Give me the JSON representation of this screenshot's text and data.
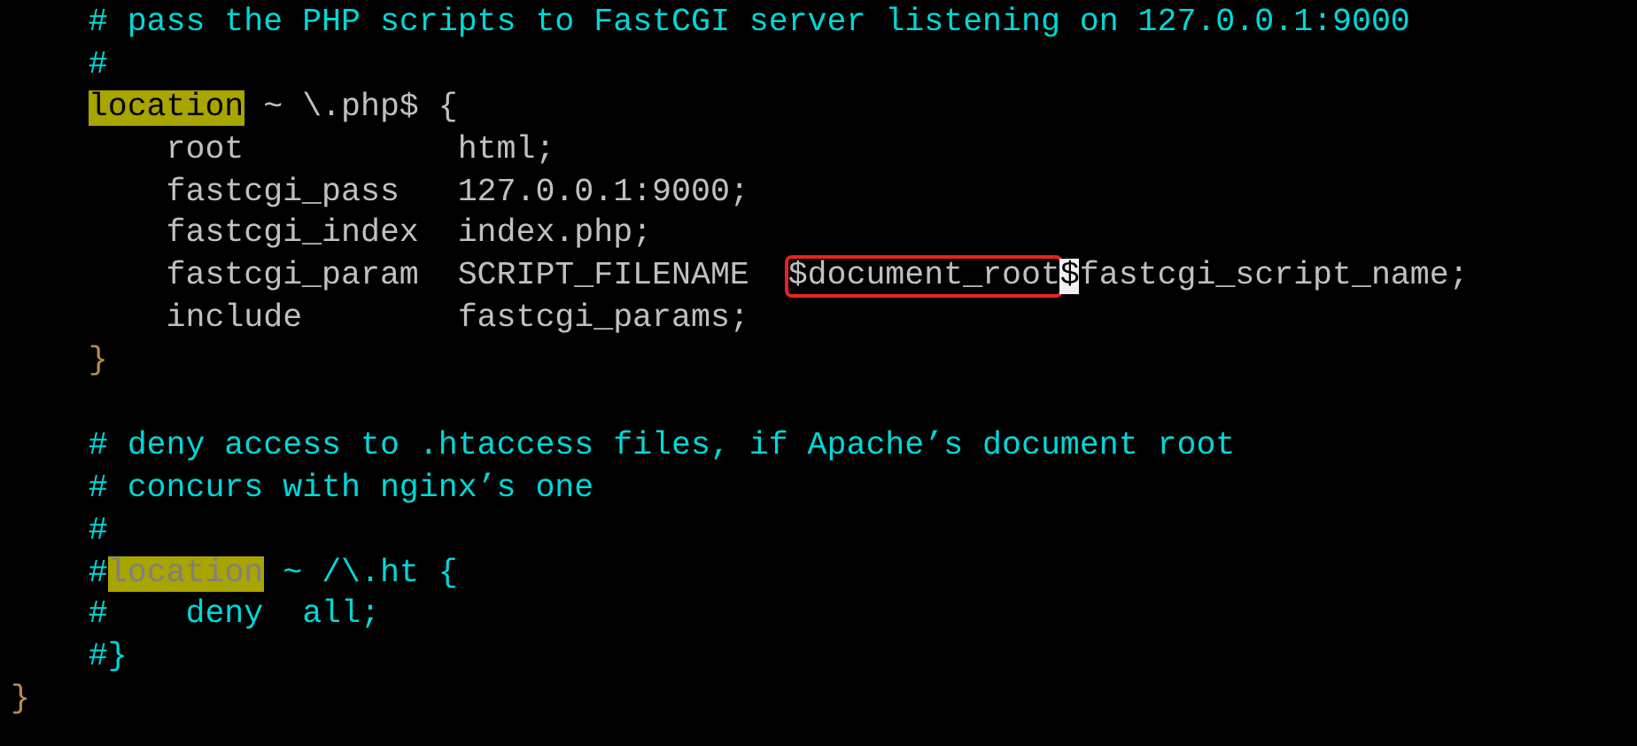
{
  "lines": [
    {
      "kind": "code",
      "segments": [
        {
          "kind": "comment",
          "text": "    # pass the PHP scripts to FastCGI server listening on 127.0.0.1:9000"
        }
      ]
    },
    {
      "kind": "code",
      "segments": [
        {
          "kind": "comment",
          "text": "    #"
        }
      ]
    },
    {
      "kind": "code",
      "segments": [
        {
          "kind": "keyword",
          "text": "    location"
        },
        {
          "kind": "plain",
          "text": " ~ \\.php$ {"
        }
      ]
    },
    {
      "kind": "code",
      "segments": [
        {
          "kind": "plain",
          "text": "        root           html;"
        }
      ]
    },
    {
      "kind": "code",
      "segments": [
        {
          "kind": "plain",
          "text": "        fastcgi_pass   127.0.0.1:9000;"
        }
      ]
    },
    {
      "kind": "code",
      "segments": [
        {
          "kind": "plain",
          "text": "        fastcgi_index  index.php;"
        }
      ]
    },
    {
      "kind": "code",
      "segments": [
        {
          "kind": "plain",
          "text": "        fastcgi_param  SCRIPT_FILENAME  "
        },
        {
          "kind": "boxed",
          "text": "$document_root"
        },
        {
          "kind": "cursor",
          "text": "$"
        },
        {
          "kind": "plain",
          "text": "fastcgi_script_name;"
        }
      ]
    },
    {
      "kind": "code",
      "segments": [
        {
          "kind": "plain",
          "text": "        include        fastcgi_params;"
        }
      ]
    },
    {
      "kind": "code",
      "segments": [
        {
          "kind": "brace",
          "text": "    }"
        }
      ]
    },
    {
      "kind": "blank"
    },
    {
      "kind": "code",
      "segments": [
        {
          "kind": "comment",
          "text": "    # deny access to .htaccess files, if Apache’s document root"
        }
      ]
    },
    {
      "kind": "code",
      "segments": [
        {
          "kind": "comment",
          "text": "    # concurs with nginx’s one"
        }
      ]
    },
    {
      "kind": "code",
      "segments": [
        {
          "kind": "comment",
          "text": "    #"
        }
      ]
    },
    {
      "kind": "code",
      "segments": [
        {
          "kind": "comment",
          "text": "    #"
        },
        {
          "kind": "keyword-commented",
          "text": "location"
        },
        {
          "kind": "comment",
          "text": " ~ /\\.ht {"
        }
      ]
    },
    {
      "kind": "code",
      "segments": [
        {
          "kind": "comment",
          "text": "    #    deny  all;"
        }
      ]
    },
    {
      "kind": "code",
      "segments": [
        {
          "kind": "comment",
          "text": "    #}"
        }
      ]
    },
    {
      "kind": "code",
      "segments": [
        {
          "kind": "brace",
          "text": "}"
        }
      ]
    }
  ]
}
